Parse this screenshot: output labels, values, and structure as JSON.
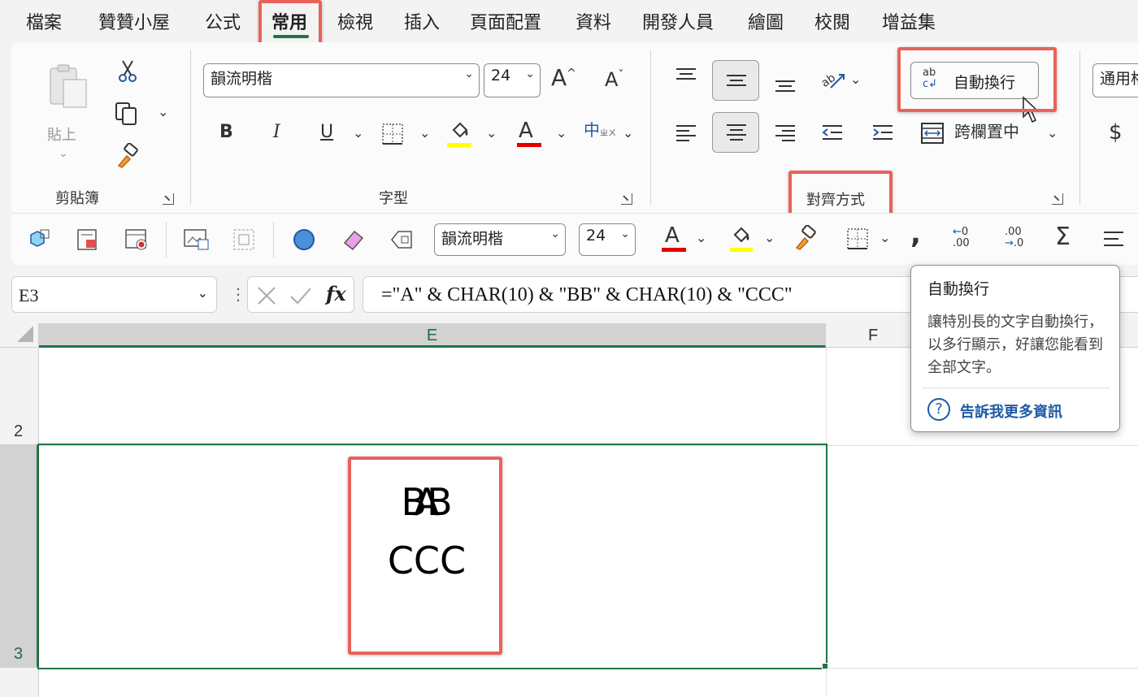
{
  "menu": {
    "items": [
      "檔案",
      "贊贊小屋",
      "公式",
      "常用",
      "檢視",
      "插入",
      "頁面配置",
      "資料",
      "開發人員",
      "繪圖",
      "校閱",
      "增益集"
    ],
    "active": "常用"
  },
  "ribbon": {
    "clipboard": {
      "paste_label": "貼上",
      "group_label": "剪貼簿"
    },
    "font": {
      "font_name": "韻流明楷",
      "font_size": "24",
      "group_label": "字型",
      "bold": "B",
      "italic": "I",
      "underline": "U",
      "font_color_letter": "A",
      "grow_font": "A",
      "shrink_font": "A",
      "phonetic": "中",
      "colors": {
        "font_color": "#e00000",
        "highlight": "#ffff00"
      }
    },
    "alignment": {
      "wrap_text_label": "自動換行",
      "merge_center_label": "跨欄置中",
      "group_label": "對齊方式"
    },
    "number": {
      "format_label": "通用格",
      "currency": "$"
    }
  },
  "quick_access": {
    "font_name": "韻流明楷",
    "font_size": "24",
    "font_color_letter": "A",
    "comma": ",",
    "inc_decimal": ".00",
    "dec_decimal": ".00",
    "sum": "Σ"
  },
  "formula_bar": {
    "name_box": "E3",
    "fx": "fx",
    "formula": "=\"A\" &  CHAR(10) & \"BB\" & CHAR(10) & \"CCC\""
  },
  "grid": {
    "columns": [
      "E",
      "F"
    ],
    "rows": [
      "2",
      "3"
    ],
    "active_cell_lines": [
      "A",
      "BB",
      "CCC"
    ],
    "accent": "#217346"
  },
  "tooltip": {
    "title": "自動換行",
    "description": "讓特別長的文字自動換行，以多行顯示，好讓您能看到全部文字。",
    "link": "告訴我更多資訊"
  },
  "highlight_color": "#e8625a"
}
